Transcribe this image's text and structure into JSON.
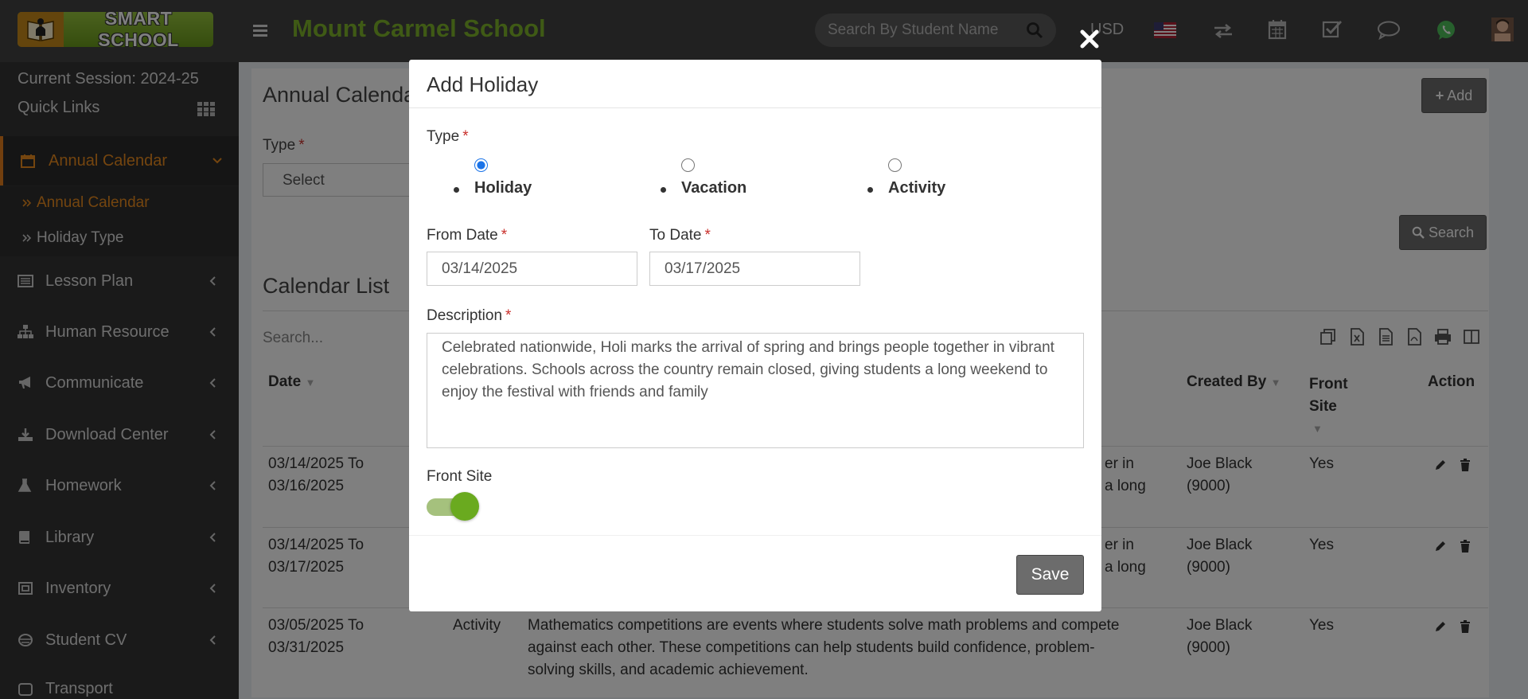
{
  "topbar": {
    "logo_text": "SMART SCHOOL",
    "school_name": "Mount Carmel School",
    "search_placeholder": "Search By Student Name",
    "currency": "USD"
  },
  "sidebar": {
    "session": "Current Session: 2024-25",
    "quick_links": "Quick Links",
    "menu": [
      {
        "label": "Annual Calendar"
      },
      {
        "label": "Lesson Plan"
      },
      {
        "label": "Human Resource"
      },
      {
        "label": "Communicate"
      },
      {
        "label": "Download Center"
      },
      {
        "label": "Homework"
      },
      {
        "label": "Library"
      },
      {
        "label": "Inventory"
      },
      {
        "label": "Student CV"
      },
      {
        "label": "Transport"
      }
    ],
    "submenu": [
      {
        "label": "Annual Calendar"
      },
      {
        "label": "Holiday Type"
      }
    ]
  },
  "page": {
    "title": "Annual Calendar",
    "add_label": "Add",
    "type_label": "Type",
    "select_placeholder": "Select",
    "search_label": "Search",
    "list_title": "Calendar List",
    "list_search_placeholder": "Search...",
    "columns": {
      "date": "Date",
      "created_by": "Created By",
      "front_site_1": "Front",
      "front_site_2": "Site",
      "action": "Action"
    },
    "rows": [
      {
        "date_1": "03/14/2025 To",
        "date_2": "03/16/2025",
        "type": "",
        "desc_1": "er in",
        "desc_2": "a long",
        "desc_3": "",
        "created_1": "Joe Black",
        "created_2": "(9000)",
        "front": "Yes"
      },
      {
        "date_1": "03/14/2025 To",
        "date_2": "03/17/2025",
        "type": "",
        "desc_1": "er in",
        "desc_2": "a long",
        "desc_3": "",
        "created_1": "Joe Black",
        "created_2": "(9000)",
        "front": "Yes"
      },
      {
        "date_1": "03/05/2025 To",
        "date_2": "03/31/2025",
        "type": "Activity",
        "desc_1": "Mathematics competitions are events where students solve math problems and compete",
        "desc_2": "against each other. These competitions can help students build confidence, problem-",
        "desc_3": "solving skills, and academic achievement.",
        "created_1": "Joe Black",
        "created_2": "(9000)",
        "front": "Yes"
      }
    ]
  },
  "modal": {
    "title": "Add Holiday",
    "type_label": "Type",
    "required_mark": "*",
    "options": [
      {
        "label": "Holiday",
        "checked": true
      },
      {
        "label": "Vacation",
        "checked": false
      },
      {
        "label": "Activity",
        "checked": false
      }
    ],
    "from_date_label": "From Date",
    "from_date_value": "03/14/2025",
    "to_date_label": "To Date",
    "to_date_value": "03/17/2025",
    "description_label": "Description",
    "description_value": "Celebrated nationwide, Holi marks the arrival of spring and brings people together in vibrant celebrations. Schools across the country remain closed, giving students a long weekend to enjoy the festival with friends and family",
    "front_site_label": "Front Site",
    "front_site_on": true,
    "save_label": "Save"
  }
}
